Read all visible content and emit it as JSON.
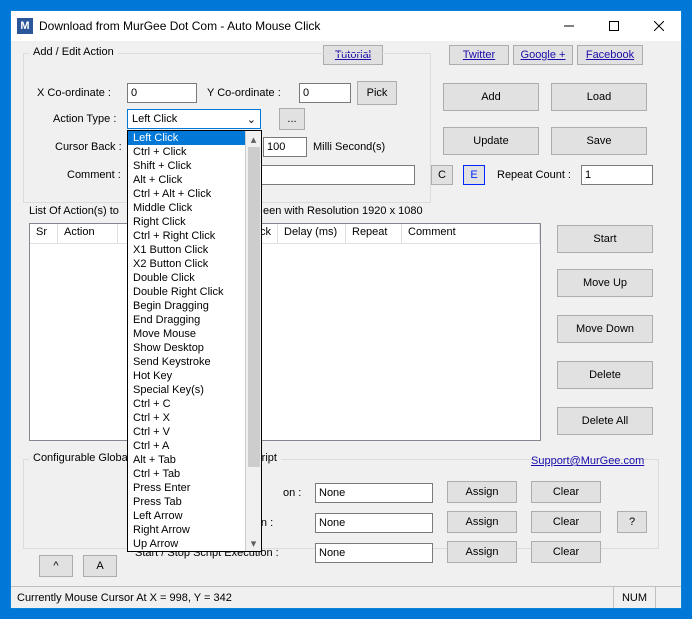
{
  "window": {
    "title": "Download from MurGee Dot Com - Auto Mouse Click",
    "icon_letter": "M"
  },
  "top_links": {
    "tutorial": "Tutorial",
    "twitter": "Twitter",
    "google": "Google +",
    "facebook": "Facebook"
  },
  "group": {
    "title": "Add / Edit Action",
    "hotkey_title": "Configurable Global HotKeys to Control this Script"
  },
  "labels": {
    "x": "X Co-ordinate :",
    "y": "Y Co-ordinate :",
    "pick": "Pick",
    "action_type": "Action Type :",
    "ellipsis": "...",
    "cursor_back": "Cursor Back :",
    "milli": "Milli Second(s)",
    "comment": "Comment :",
    "c": "C",
    "e": "E",
    "repeat_count": "Repeat Count :",
    "list_of": "List Of Action(s) to",
    "resolution_tail": "een with Resolution 1920 x 1080",
    "get_position_row": "Get Mouse Cursor Position :",
    "exec_row": "Start / Stop Script Execution :",
    "partial_row": "on :",
    "support": "Support@MurGee.com"
  },
  "values": {
    "x": "0",
    "y": "0",
    "delay_suffix": "100",
    "comment": "",
    "repeat": "1",
    "action_type_selected": "Left Click",
    "hk1": "None",
    "hk2": "None",
    "hk3": "None"
  },
  "buttons": {
    "add": "Add",
    "load": "Load",
    "update": "Update",
    "save": "Save",
    "start": "Start",
    "move_up": "Move Up",
    "move_down": "Move Down",
    "delete": "Delete",
    "delete_all": "Delete All",
    "assign": "Assign",
    "clear": "Clear",
    "qm": "?",
    "caret": "^",
    "a": "A"
  },
  "table": {
    "cols": [
      "Sr",
      "Action",
      "ck",
      "Delay (ms)",
      "Repeat",
      "Comment"
    ]
  },
  "dropdown": {
    "selected_index": 0,
    "items": [
      "Left Click",
      "Ctrl + Click",
      "Shift + Click",
      "Alt + Click",
      "Ctrl + Alt + Click",
      "Middle Click",
      "Right Click",
      "Ctrl + Right Click",
      "X1 Button Click",
      "X2 Button Click",
      "Double Click",
      "Double Right Click",
      "Begin Dragging",
      "End Dragging",
      "Move Mouse",
      "Show Desktop",
      "Send Keystroke",
      "Hot Key",
      "Special Key(s)",
      "Ctrl + C",
      "Ctrl + X",
      "Ctrl + V",
      "Ctrl + A",
      "Alt + Tab",
      "Ctrl + Tab",
      "Press Enter",
      "Press Tab",
      "Left Arrow",
      "Right Arrow",
      "Up Arrow"
    ]
  },
  "status": {
    "left": "Currently Mouse Cursor At X = 998, Y = 342",
    "right": "NUM"
  }
}
